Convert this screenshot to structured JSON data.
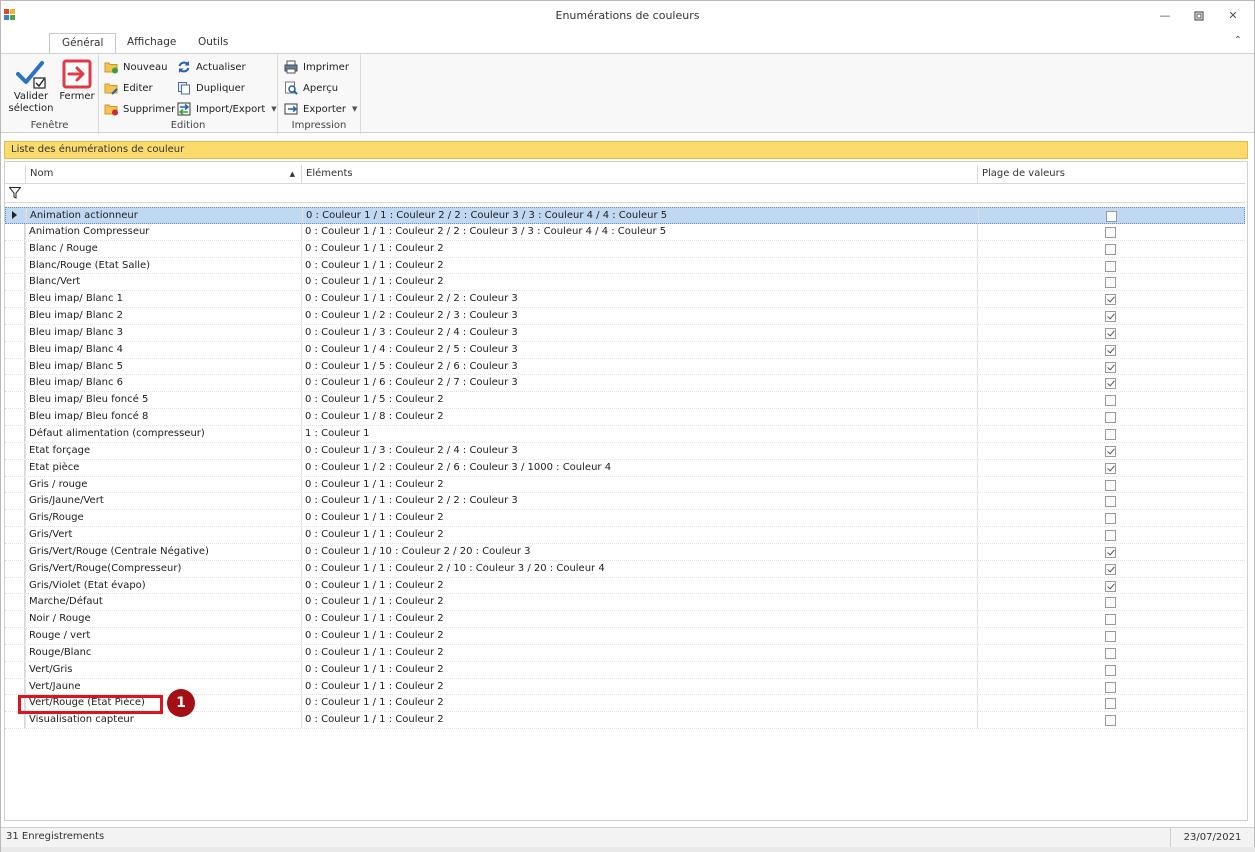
{
  "window": {
    "title": "Enumérations de couleurs"
  },
  "tabs": [
    {
      "label": "Général",
      "active": true
    },
    {
      "label": "Affichage",
      "active": false
    },
    {
      "label": "Outils",
      "active": false
    }
  ],
  "ribbon": {
    "fenetre": {
      "label": "Fenêtre",
      "valider": "Valider\nsélection",
      "fermer": "Fermer"
    },
    "edition": {
      "label": "Edition",
      "nouveau": "Nouveau",
      "editer": "Editer",
      "supprimer": "Supprimer",
      "actualiser": "Actualiser",
      "dupliquer": "Dupliquer",
      "import_export": "Import/Export"
    },
    "impression": {
      "label": "Impression",
      "imprimer": "Imprimer",
      "apercu": "Aperçu",
      "exporter": "Exporter"
    }
  },
  "list": {
    "title": "Liste des énumérations de couleur",
    "columns": {
      "nom": "Nom",
      "elements": "Eléments",
      "plage": "Plage de valeurs"
    },
    "rows": [
      {
        "nom": "Animation actionneur",
        "el": "0 : Couleur 1 / 1 : Couleur 2 / 2 : Couleur 3 / 3 : Couleur 4 / 4 : Couleur 5",
        "plage": false
      },
      {
        "nom": "Animation Compresseur",
        "el": "0 : Couleur 1 / 1 : Couleur 2 / 2 : Couleur 3 / 3 : Couleur 4 / 4 : Couleur 5",
        "plage": false
      },
      {
        "nom": "Blanc / Rouge",
        "el": "0 : Couleur 1 / 1 : Couleur 2",
        "plage": false
      },
      {
        "nom": "Blanc/Rouge (Etat Salle)",
        "el": "0 : Couleur 1 / 1 : Couleur 2",
        "plage": false
      },
      {
        "nom": "Blanc/Vert",
        "el": "0 : Couleur 1 / 1 : Couleur 2",
        "plage": false
      },
      {
        "nom": "Bleu imap/ Blanc 1",
        "el": "0 : Couleur 1 / 1 : Couleur 2 / 2 : Couleur 3",
        "plage": true
      },
      {
        "nom": "Bleu imap/ Blanc 2",
        "el": "0 : Couleur 1 / 2 : Couleur 2 / 3 : Couleur 3",
        "plage": true
      },
      {
        "nom": "Bleu imap/ Blanc 3",
        "el": "0 : Couleur 1 / 3 : Couleur 2 / 4 : Couleur 3",
        "plage": true
      },
      {
        "nom": "Bleu imap/ Blanc 4",
        "el": "0 : Couleur 1 / 4 : Couleur 2 / 5 : Couleur 3",
        "plage": true
      },
      {
        "nom": "Bleu imap/ Blanc 5",
        "el": "0 : Couleur 1 / 5 : Couleur 2 / 6 : Couleur 3",
        "plage": true
      },
      {
        "nom": "Bleu imap/ Blanc 6",
        "el": "0 : Couleur 1 / 6 : Couleur 2 / 7 : Couleur 3",
        "plage": true
      },
      {
        "nom": "Bleu imap/ Bleu foncé 5",
        "el": "0 : Couleur 1 / 5 : Couleur 2",
        "plage": false
      },
      {
        "nom": "Bleu imap/ Bleu foncé 8",
        "el": "0 : Couleur 1 / 8 : Couleur 2",
        "plage": false
      },
      {
        "nom": "Défaut alimentation (compresseur)",
        "el": "1 : Couleur 1",
        "plage": false
      },
      {
        "nom": "Etat forçage",
        "el": "0 : Couleur 1 / 3 : Couleur 2 / 4 : Couleur 3",
        "plage": true
      },
      {
        "nom": "Etat pièce",
        "el": "0 : Couleur 1 / 2 : Couleur 2 / 6 : Couleur 3 / 1000 : Couleur 4",
        "plage": true
      },
      {
        "nom": "Gris / rouge",
        "el": "0 : Couleur 1 / 1 : Couleur 2",
        "plage": false
      },
      {
        "nom": "Gris/Jaune/Vert",
        "el": "0 : Couleur 1 / 1 : Couleur 2 / 2 : Couleur 3",
        "plage": false
      },
      {
        "nom": "Gris/Rouge",
        "el": "0 : Couleur 1 / 1 : Couleur 2",
        "plage": false
      },
      {
        "nom": "Gris/Vert",
        "el": "0 : Couleur 1 / 1 : Couleur 2",
        "plage": false
      },
      {
        "nom": "Gris/Vert/Rouge (Centrale Négative)",
        "el": "0 : Couleur 1 / 10 : Couleur 2 / 20 : Couleur 3",
        "plage": true
      },
      {
        "nom": "Gris/Vert/Rouge(Compresseur)",
        "el": "0 : Couleur 1 / 1 : Couleur 2 / 10 : Couleur 3 / 20 : Couleur 4",
        "plage": true
      },
      {
        "nom": "Gris/Violet (Etat évapo)",
        "el": "0 : Couleur 1 / 1 : Couleur 2",
        "plage": true
      },
      {
        "nom": "Marche/Défaut",
        "el": "0 : Couleur 1 / 1 : Couleur 2",
        "plage": false
      },
      {
        "nom": "Noir / Rouge",
        "el": "0 : Couleur 1 / 1 : Couleur 2",
        "plage": false
      },
      {
        "nom": "Rouge / vert",
        "el": "0 : Couleur 1 / 1 : Couleur 2",
        "plage": false
      },
      {
        "nom": "Rouge/Blanc",
        "el": "0 : Couleur 1 / 1 : Couleur 2",
        "plage": false
      },
      {
        "nom": "Vert/Gris",
        "el": "0 : Couleur 1 / 1 : Couleur 2",
        "plage": false
      },
      {
        "nom": "Vert/Jaune",
        "el": "0 : Couleur 1 / 1 : Couleur 2",
        "plage": false
      },
      {
        "nom": "Vert/Rouge (Etat Pièce)",
        "el": "0 : Couleur 1 / 1 : Couleur 2",
        "plage": false
      },
      {
        "nom": "Visualisation capteur",
        "el": "0 : Couleur 1 / 1 : Couleur 2",
        "plage": false
      }
    ]
  },
  "annotation": {
    "badge": "1"
  },
  "status": {
    "count": "31 Enregistrements",
    "date": "23/07/2021"
  },
  "colors": {
    "header_yellow": "#fcdb6e",
    "selection": "#c0d9f2",
    "highlight": "#e0131d",
    "badge": "#a30f12"
  }
}
